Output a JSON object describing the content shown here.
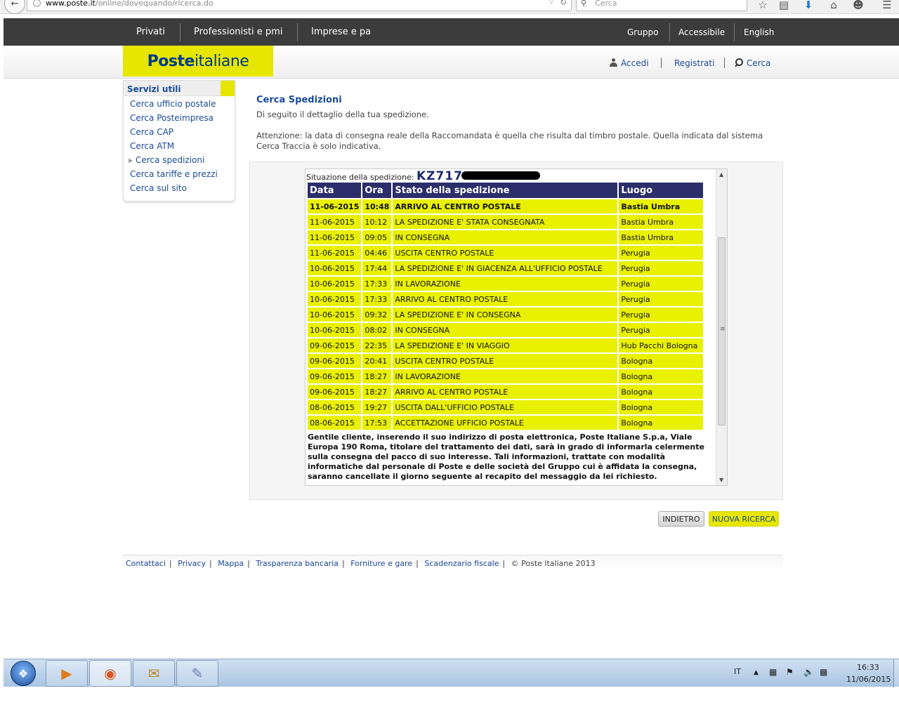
{
  "browser": {
    "url_domain": "www.poste.it",
    "url_path": "/online/dovequando/ricerca.do",
    "search_placeholder": "Cerca"
  },
  "topnav": {
    "left": [
      "Privati",
      "Professionisti e pmi",
      "Imprese e pa"
    ],
    "right": [
      "Gruppo",
      "Accessibile",
      "English"
    ]
  },
  "header": {
    "logo_bold": "Poste",
    "logo_light": "italiane",
    "accedi": "Accedi",
    "registrati": "Registrati",
    "cerca": "Cerca"
  },
  "sidebar": {
    "title": "Servizi utili",
    "items": [
      "Cerca ufficio postale",
      "Cerca Posteimpresa",
      "Cerca CAP",
      "Cerca ATM",
      "Cerca spedizioni",
      "Cerca tariffe e prezzi",
      "Cerca sul sito"
    ]
  },
  "main": {
    "title": "Cerca Spedizioni",
    "intro": "Di seguito il dettaglio della tua spedizione.",
    "warning_line1": "Attenzione: la data di consegna reale della Raccomandata è quella che risulta dal timbro postale. Quella indicata dal sistema",
    "warning_line2": "Cerca Traccia è solo indicativa."
  },
  "tracking": {
    "label": "Situazione della spedizione:",
    "code_visible": "KZ717",
    "headers": [
      "Data",
      "Ora",
      "Stato della spedizione",
      "Luogo"
    ],
    "rows": [
      [
        "11-06-2015",
        "10:48",
        "ARRIVO AL CENTRO POSTALE",
        "Bastia Umbra"
      ],
      [
        "11-06-2015",
        "10:12",
        "LA SPEDIZIONE E' STATA CONSEGNATA",
        "Bastia Umbra"
      ],
      [
        "11-06-2015",
        "09:05",
        "IN CONSEGNA",
        "Bastia Umbra"
      ],
      [
        "11-06-2015",
        "04:46",
        "USCITA CENTRO POSTALE",
        "Perugia"
      ],
      [
        "10-06-2015",
        "17:44",
        "LA SPEDIZIONE E' IN GIACENZA ALL'UFFICIO POSTALE",
        "Perugia"
      ],
      [
        "10-06-2015",
        "17:33",
        "IN LAVORAZIONE",
        "Perugia"
      ],
      [
        "10-06-2015",
        "17:33",
        "ARRIVO AL CENTRO POSTALE",
        "Perugia"
      ],
      [
        "10-06-2015",
        "09:32",
        "LA SPEDIZIONE E' IN CONSEGNA",
        "Perugia"
      ],
      [
        "10-06-2015",
        "08:02",
        "IN CONSEGNA",
        "Perugia"
      ],
      [
        "09-06-2015",
        "22:35",
        "LA SPEDIZIONE E' IN VIAGGIO",
        "Hub Pacchi Bologna"
      ],
      [
        "09-06-2015",
        "20:41",
        "USCITA CENTRO POSTALE",
        "Bologna"
      ],
      [
        "09-06-2015",
        "18:27",
        "IN LAVORAZIONE",
        "Bologna"
      ],
      [
        "09-06-2015",
        "18:27",
        "ARRIVO AL CENTRO POSTALE",
        "Bologna"
      ],
      [
        "08-06-2015",
        "19:27",
        "USCITA DALL'UFFICIO POSTALE",
        "Bologna"
      ],
      [
        "08-06-2015",
        "17:53",
        "ACCETTAZIONE UFFICIO POSTALE",
        "Bologna"
      ]
    ],
    "note": "Gentile cliente, inserendo il suo indirizzo di posta elettronica, Poste Italiane S.p.a, Viale Europa 190 Roma, titolare del trattamento dei dati, sarà in grado di informarla celermente sulla consegna del pacco di suo interesse. Tali informazioni, trattate con modalità informatiche dal personale di Poste e delle società del Gruppo cui è affidata la consegna, saranno cancellate il giorno seguente al recapito del messaggio da lei richiesto."
  },
  "buttons": {
    "back": "INDIETRO",
    "new_search": "NUOVA RICERCA"
  },
  "footer": {
    "links": [
      "Contattaci",
      "Privacy",
      "Mappa",
      "Trasparenza bancaria",
      "Forniture e gare",
      "Scadenzario fiscale"
    ],
    "copyright": "© Poste italiane 2013"
  },
  "taskbar": {
    "lang": "IT",
    "time": "16:33",
    "date": "11/06/2015"
  },
  "colors": {
    "brand_yellow": "#e7e600",
    "brand_blue": "#1a4a99",
    "table_header": "#2b2e6b",
    "row_yellow": "#e9f100",
    "nav_dark": "#3c3c3c"
  }
}
